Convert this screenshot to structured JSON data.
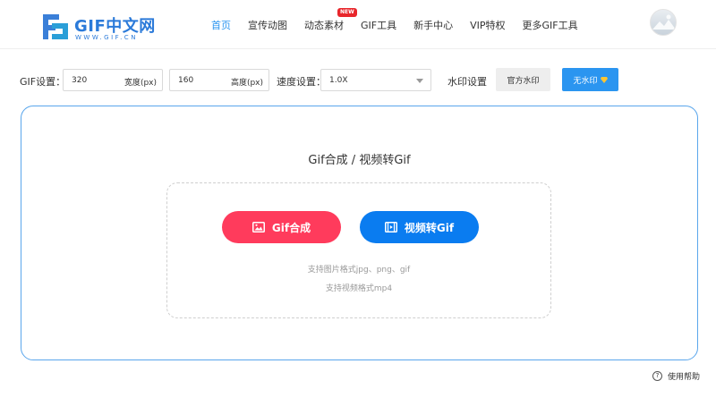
{
  "header": {
    "logo_title": "GIF中文网",
    "logo_sub": "WWW.GIF.CN",
    "nav": [
      {
        "label": "首页",
        "active": true
      },
      {
        "label": "宣传动图"
      },
      {
        "label": "动态素材",
        "badge": "NEW"
      },
      {
        "label": "GIF工具"
      },
      {
        "label": "新手中心"
      },
      {
        "label": "VIP特权"
      },
      {
        "label": "更多GIF工具"
      }
    ]
  },
  "settings": {
    "gif_label": "GIF设置：",
    "width_value": "320",
    "width_unit": "宽度(px)",
    "height_value": "160",
    "height_unit": "高度(px)",
    "speed_label": "速度设置：",
    "speed_value": "1.0X",
    "watermark_label": "水印设置",
    "official_watermark": "官方水印",
    "no_watermark": "无水印"
  },
  "main": {
    "title": "Gif合成 / 视频转Gif",
    "gif_compose_button": "Gif合成",
    "video_to_gif_button": "视频转Gif",
    "hint_images": "支持图片格式jpg、png、gif",
    "hint_video": "支持视频格式mp4"
  },
  "footer": {
    "help_label": "使用帮助",
    "help_icon_glyph": "?"
  },
  "colors": {
    "accent": "#2b95f0",
    "red_button": "#ff3b5c",
    "blue_button": "#0a7cf0",
    "panel_border": "#5aa6ec"
  }
}
